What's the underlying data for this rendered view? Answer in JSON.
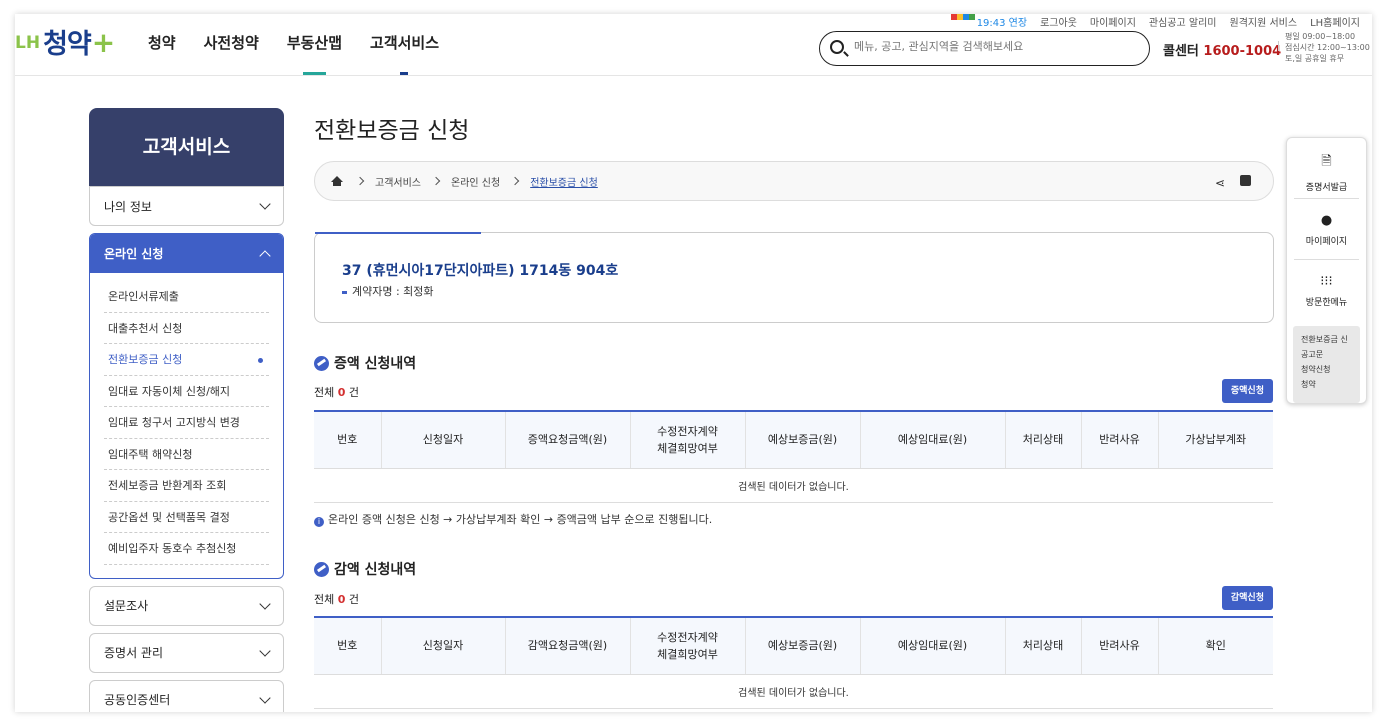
{
  "header": {
    "logo_lh": "LH",
    "logo_main": "청약",
    "logo_plus": "+",
    "gnb": [
      "청약",
      "사전청약",
      "부동산맵",
      "고객서비스"
    ],
    "util": [
      "19:43 연장",
      "로그아웃",
      "마이페이지",
      "관심공고 알리미",
      "원격지원 서비스",
      "LH홈페이지"
    ],
    "search_placeholder": "메뉴, 공고, 관심지역을 검색해보세요",
    "call_label": "콜센터",
    "call_number": "1600-1004",
    "hours": [
      "평일 09:00~18:00",
      "점심시간 12:00~13:00",
      "토,일 공휴일 휴무"
    ]
  },
  "lnb": {
    "title": "고객서비스",
    "my_info": "나의 정보",
    "online_apply": "온라인 신청",
    "sub_items": [
      "온라인서류제출",
      "대출추천서 신청",
      "전환보증금 신청",
      "임대료 자동이체 신청/해지",
      "임대료 청구서 고지방식 변경",
      "임대주택 해약신청",
      "전세보증금 반환계좌 조회",
      "공간옵션 및 선택품목 결정",
      "예비입주자 동호수 추첨신청"
    ],
    "survey": "설문조사",
    "cert_manage": "증명서 관리",
    "cert_center": "공동인증센터"
  },
  "page": {
    "title": "전환보증금 신청",
    "breadcrumb": [
      "고객서비스",
      "온라인 신청",
      "전환보증금 신청"
    ],
    "address": "37 (휴먼시아17단지아파트) 1714동 904호",
    "contractor": "계약자명 : 최정화"
  },
  "increase": {
    "title": "증액 신청내역",
    "count_prefix": "전체",
    "count": "0",
    "count_suffix": "건",
    "button": "증액신청",
    "headers": [
      "번호",
      "신청일자",
      "증액요청금액(원)",
      "수정전자계약\n체결희망여부",
      "예상보증금(원)",
      "예상임대료(원)",
      "처리상태",
      "반려사유",
      "가상납부계좌"
    ],
    "empty": "검색된 데이터가 없습니다.",
    "note": "온라인 증액 신청은 신청 → 가상납부계좌 확인 → 증액금액 납부 순으로 진행됩니다."
  },
  "decrease": {
    "title": "감액 신청내역",
    "count_prefix": "전체",
    "count": "0",
    "count_suffix": "건",
    "button": "감액신청",
    "headers": [
      "번호",
      "신청일자",
      "감액요청금액(원)",
      "수정전자계약\n체결희망여부",
      "예상보증금(원)",
      "예상임대료(원)",
      "처리상태",
      "반려사유",
      "확인"
    ],
    "empty": "검색된 데이터가 없습니다."
  },
  "quick": {
    "items": [
      "증명서발급",
      "마이페이지",
      "방문한메뉴"
    ],
    "recent": [
      "전환보증금 신",
      "공고문",
      "청약신청",
      "청약"
    ]
  },
  "colors": {
    "navy": "#36406a",
    "accent": "#3f5fc6",
    "brand_green": "#8bc34a",
    "brand_blue": "#1a3e8c",
    "call_red": "#b71c1c"
  }
}
